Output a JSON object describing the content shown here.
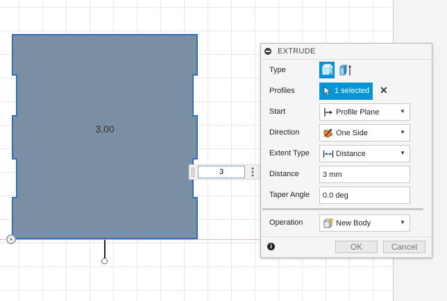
{
  "canvas": {
    "dimension_label": "3.00",
    "hud_value": "3"
  },
  "dialog": {
    "title": "EXTRUDE",
    "rows": {
      "type": {
        "label": "Type"
      },
      "profiles": {
        "label": "Profiles",
        "value": "1 selected"
      },
      "start": {
        "label": "Start",
        "value": "Profile Plane"
      },
      "direction": {
        "label": "Direction",
        "value": "One Side"
      },
      "extent_type": {
        "label": "Extent Type",
        "value": "Distance"
      },
      "distance": {
        "label": "Distance",
        "value": "3 mm"
      },
      "taper_angle": {
        "label": "Taper Angle",
        "value": "0.0 deg"
      },
      "operation": {
        "label": "Operation",
        "value": "New Body"
      }
    },
    "buttons": {
      "ok": "OK",
      "cancel": "Cancel"
    }
  },
  "colors": {
    "accent": "#0696d7",
    "body_fill": "#7b8fa4",
    "body_edge": "#2f6fc2"
  },
  "icons": [
    "collapse-icon",
    "solid-extrude-icon",
    "surface-extrude-icon",
    "select-arrow-icon",
    "clear-icon",
    "profile-plane-icon",
    "one-side-icon",
    "distance-icon",
    "new-body-icon",
    "info-icon",
    "origin-icon"
  ]
}
